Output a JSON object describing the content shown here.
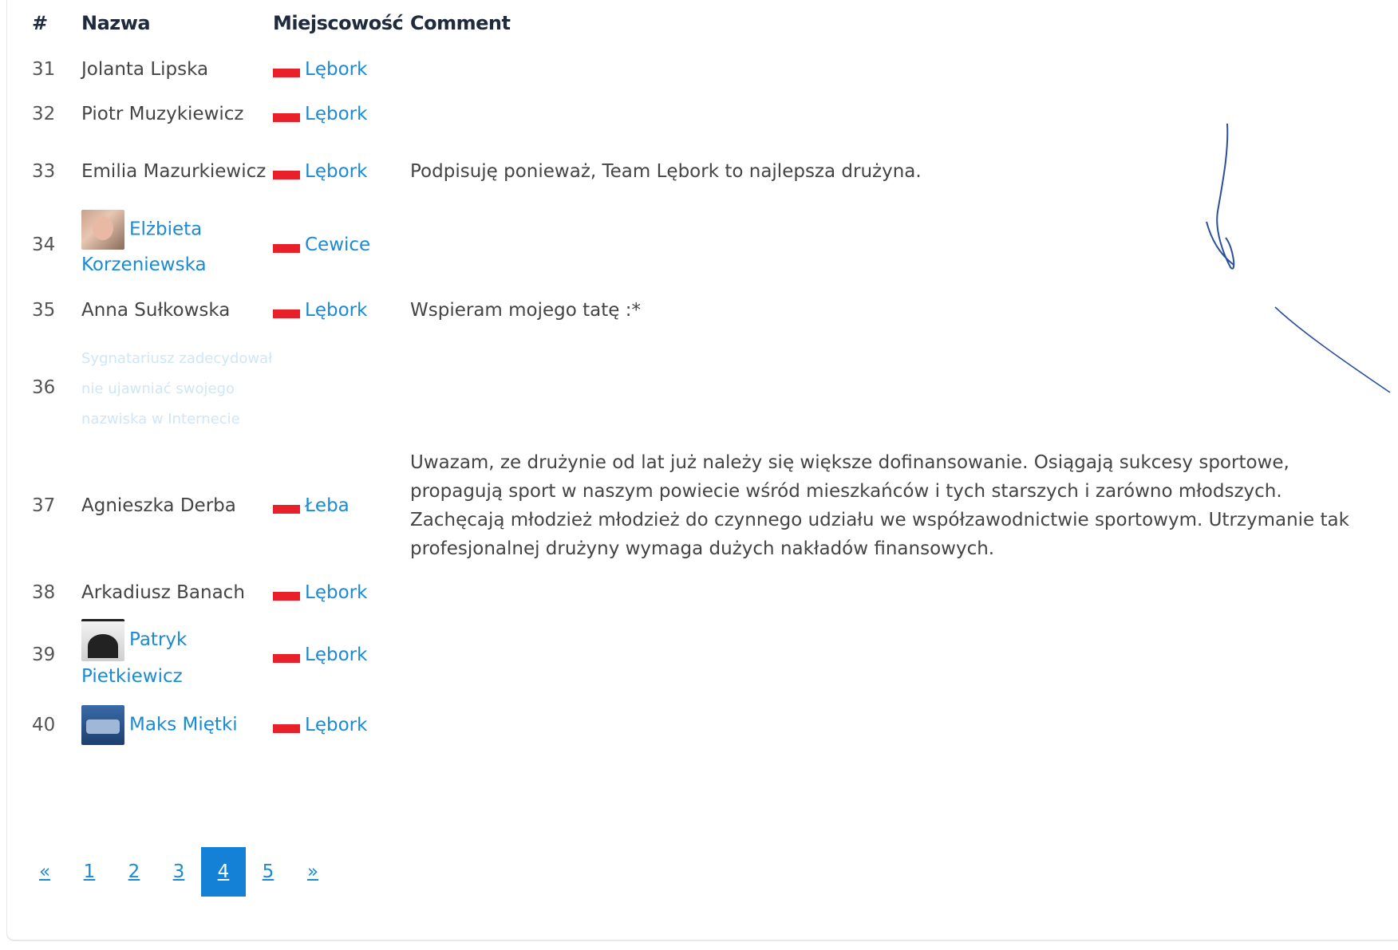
{
  "table": {
    "headers": {
      "num": "#",
      "name": "Nazwa",
      "city": "Miejscowość",
      "comment": "Comment"
    },
    "rows": [
      {
        "num": "31",
        "name": "Jolanta Lipska",
        "name_is_link": false,
        "avatar": "",
        "city": "Lębork",
        "comment": ""
      },
      {
        "num": "32",
        "name": "Piotr Muzykiewicz",
        "name_is_link": false,
        "avatar": "",
        "city": "Lębork",
        "comment": ""
      },
      {
        "num": "33",
        "name": "Emilia Mazurkiewicz",
        "name_is_link": false,
        "avatar": "",
        "city": "Lębork",
        "comment": "Podpisuję ponieważ, Team Lębork to najlepsza drużyna."
      },
      {
        "num": "34",
        "name": "Elżbieta Korzeniewska",
        "name_is_link": true,
        "avatar": "a34",
        "city": "Cewice",
        "comment": ""
      },
      {
        "num": "35",
        "name": "Anna Sułkowska",
        "name_is_link": false,
        "avatar": "",
        "city": "Lębork",
        "comment": "Wspieram mojego tatę :*"
      },
      {
        "num": "36",
        "name": "Sygnatariusz zadecydował nie ujawniać swojego nazwiska w Internecie",
        "name_is_link": false,
        "avatar": "",
        "city": "",
        "comment": "",
        "faded": true
      },
      {
        "num": "37",
        "name": "Agnieszka Derba",
        "name_is_link": false,
        "avatar": "",
        "city": "Łeba",
        "comment": "Uwazam, ze drużynie od lat już należy się większe dofinansowanie. Osiągają sukcesy sportowe, propagują sport w naszym powiecie wśród mieszkańców i tych starszych i zarówno młodszych. Zachęcają młodzież młodzież do czynnego udziału we współzawodnictwie sportowym. Utrzymanie tak profesjonalnej drużyny wymaga dużych nakładów finansowych."
      },
      {
        "num": "38",
        "name": "Arkadiusz Banach",
        "name_is_link": false,
        "avatar": "",
        "city": "Lębork",
        "comment": ""
      },
      {
        "num": "39",
        "name": "Patryk Pietkiewicz",
        "name_is_link": true,
        "avatar": "a39",
        "city": "Lębork",
        "comment": ""
      },
      {
        "num": "40",
        "name": "Maks Miętki",
        "name_is_link": true,
        "avatar": "a40",
        "city": "Lębork",
        "comment": ""
      }
    ]
  },
  "pagination": {
    "prev": "«",
    "pages": [
      "1",
      "2",
      "3",
      "4",
      "5"
    ],
    "active": "4",
    "next": "»"
  },
  "colors": {
    "link": "#1a8ad4",
    "flag": "#e8202a",
    "active_page": "#1480d6"
  },
  "icons": {
    "flag": "flag-icon",
    "avatar": "avatar"
  }
}
